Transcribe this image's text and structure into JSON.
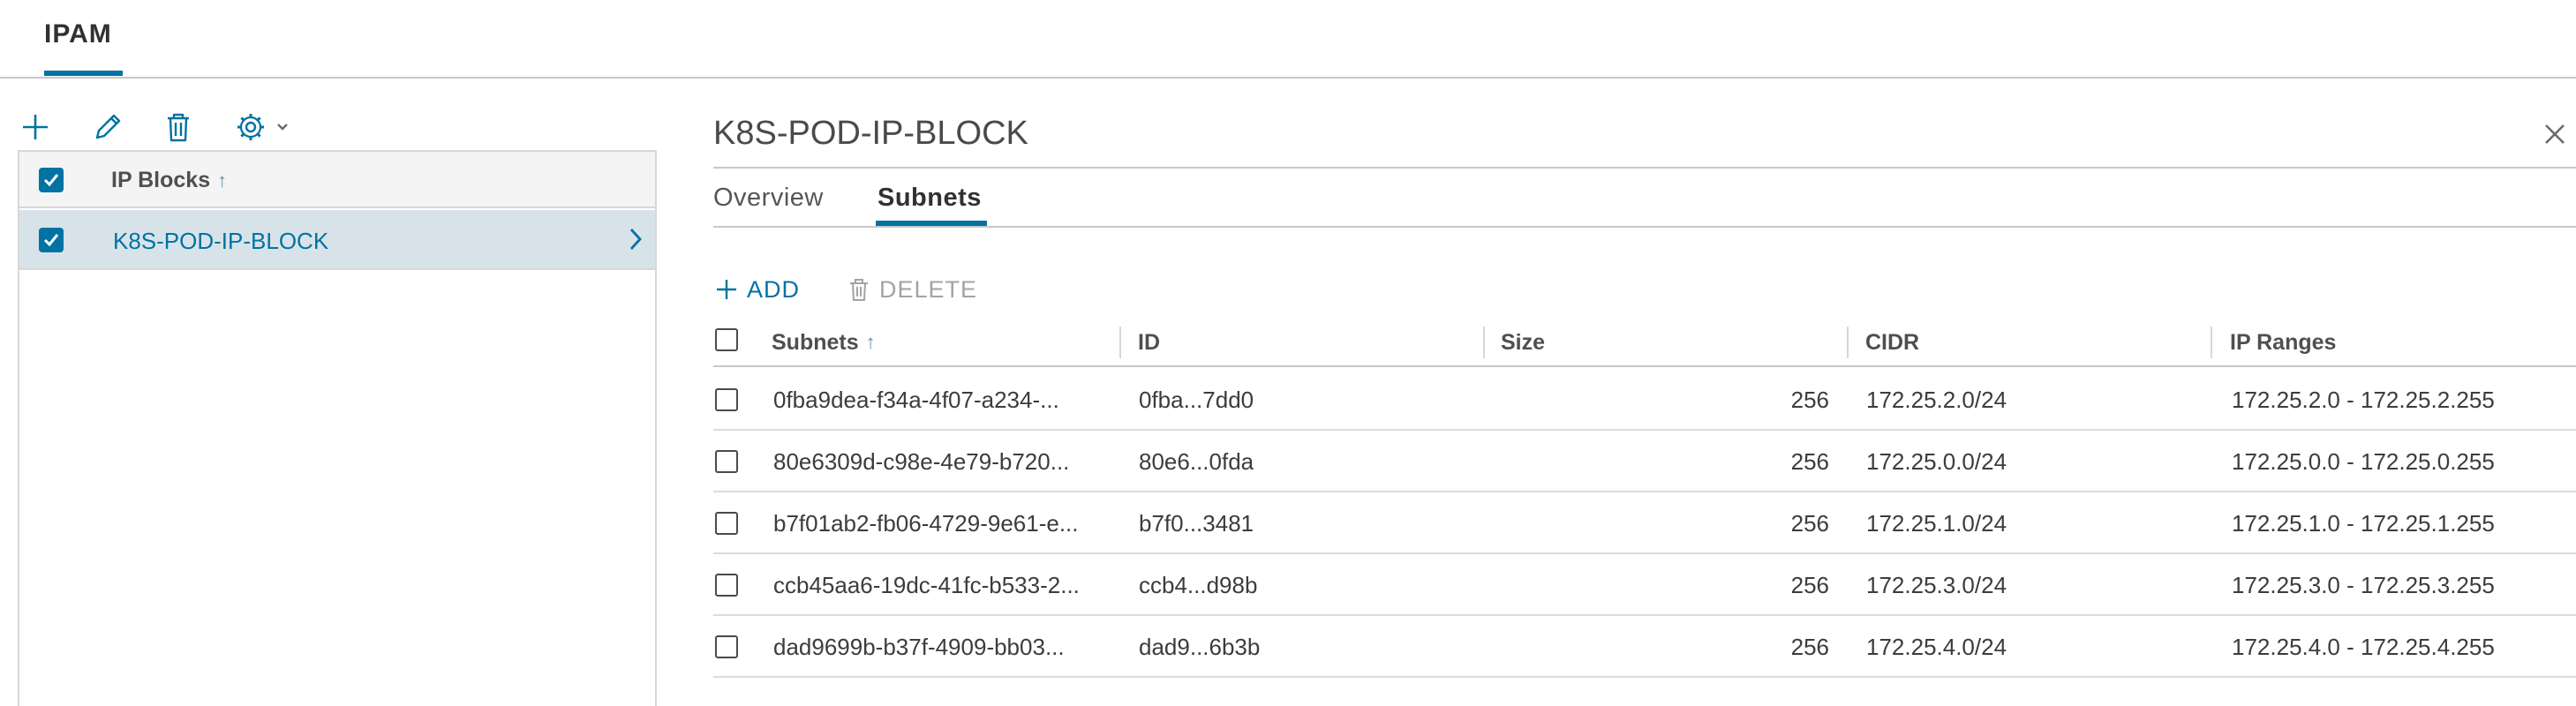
{
  "topnav": {
    "tab": "IPAM"
  },
  "left_toolbar": {
    "icons": [
      "plus-icon",
      "pencil-icon",
      "trash-icon",
      "gear-icon",
      "chevron-down-icon"
    ]
  },
  "left_panel": {
    "header": {
      "label": "IP Blocks",
      "sort": "↑"
    },
    "rows": [
      {
        "label": "K8S-POD-IP-BLOCK"
      }
    ]
  },
  "detail": {
    "title": "K8S-POD-IP-BLOCK",
    "tabs": [
      {
        "label": "Overview"
      },
      {
        "label": "Subnets",
        "active": true
      }
    ],
    "actions": {
      "add": "ADD",
      "delete": "DELETE"
    },
    "grid": {
      "columns": [
        "Subnets",
        "ID",
        "Size",
        "CIDR",
        "IP Ranges"
      ],
      "sort": "↑",
      "rows": [
        {
          "subnet": "0fba9dea-f34a-4f07-a234-...",
          "id": "0fba...7dd0",
          "size": "256",
          "cidr": "172.25.2.0/24",
          "ip_range": "172.25.2.0 - 172.25.2.255"
        },
        {
          "subnet": "80e6309d-c98e-4e79-b720...",
          "id": "80e6...0fda",
          "size": "256",
          "cidr": "172.25.0.0/24",
          "ip_range": "172.25.0.0 - 172.25.0.255"
        },
        {
          "subnet": "b7f01ab2-fb06-4729-9e61-e...",
          "id": "b7f0...3481",
          "size": "256",
          "cidr": "172.25.1.0/24",
          "ip_range": "172.25.1.0 - 172.25.1.255"
        },
        {
          "subnet": "ccb45aa6-19dc-41fc-b533-2...",
          "id": "ccb4...d98b",
          "size": "256",
          "cidr": "172.25.3.0/24",
          "ip_range": "172.25.3.0 - 172.25.3.255"
        },
        {
          "subnet": "dad9699b-b37f-4909-bb03...",
          "id": "dad9...6b3b",
          "size": "256",
          "cidr": "172.25.4.0/24",
          "ip_range": "172.25.4.0 - 172.25.4.255"
        }
      ]
    }
  },
  "colors": {
    "accent": "#0072a3",
    "selected_row": "#d8e3e9"
  }
}
